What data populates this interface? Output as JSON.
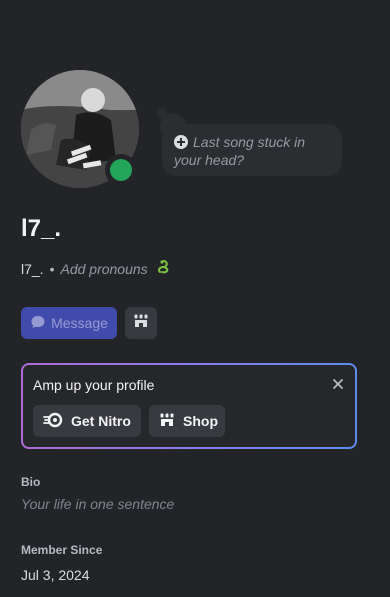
{
  "profile": {
    "display_name": "l7_.",
    "username": "l7_.",
    "separator": "•",
    "pronouns_placeholder": "Add pronouns",
    "badge_icon": "snake-icon",
    "status": "online",
    "status_color": "#23a55a"
  },
  "custom_status": {
    "placeholder": "Last song stuck in your head?",
    "icon": "plus-circle-icon"
  },
  "actions": {
    "message_label": "Message",
    "message_icon": "chat-bubble-icon",
    "shop_icon": "shop-icon"
  },
  "nitro_card": {
    "title": "Amp up your profile",
    "get_nitro_label": "Get Nitro",
    "shop_label": "Shop",
    "close_icon": "close-icon"
  },
  "bio": {
    "label": "Bio",
    "placeholder": "Your life in one sentence"
  },
  "member_since": {
    "label": "Member Since",
    "date": "Jul 3, 2024"
  },
  "colors": {
    "background": "#232428",
    "accent": "#5865f2",
    "online": "#23a55a"
  }
}
